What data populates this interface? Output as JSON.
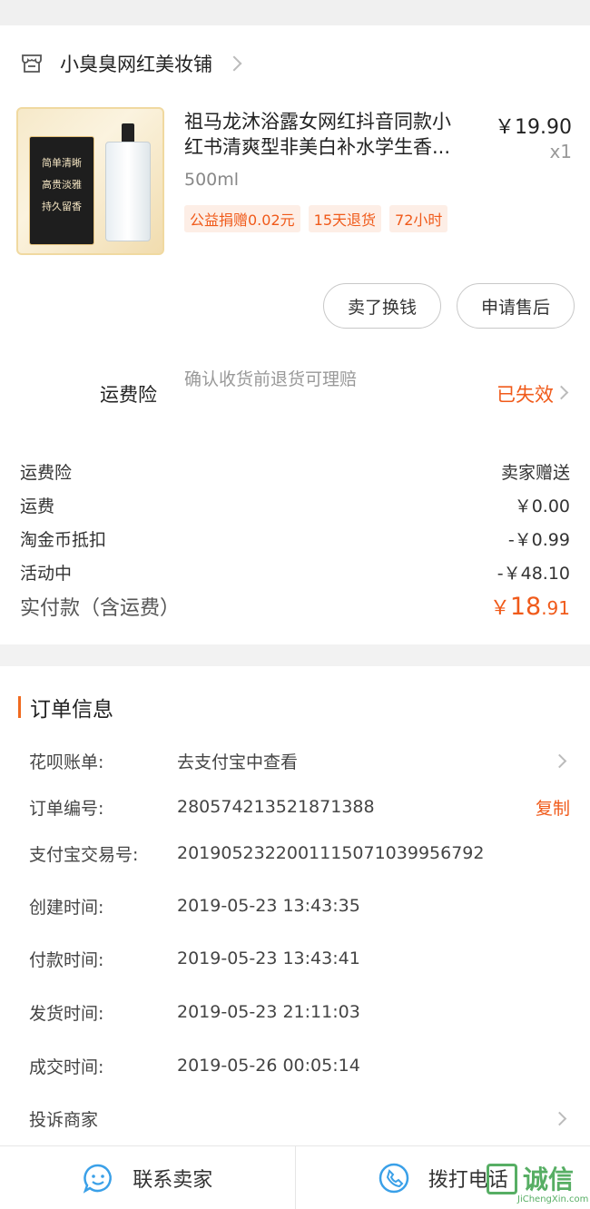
{
  "shop": {
    "name": "小臭臭网红美妆铺"
  },
  "product": {
    "title_line1": "祖马龙沐浴露女网红抖音同款小",
    "title_line2": "红书清爽型非美白补水学生香...",
    "price": "￥19.90",
    "quantity": "x1",
    "spec": "500ml",
    "tags": [
      "公益捐赠0.02元",
      "15天退货",
      "72小时"
    ],
    "image_card_lines": [
      "简单清晰",
      "高贵淡雅",
      "持久留香"
    ]
  },
  "actions": {
    "sell_label": "卖了换钱",
    "service_label": "申请售后"
  },
  "insurance": {
    "label": "运费险",
    "desc": "确认收货前退货可理赔",
    "status": "已失效"
  },
  "fees": [
    {
      "key": "运费险",
      "value": "卖家赠送"
    },
    {
      "key": "运费",
      "value": "￥0.00"
    },
    {
      "key": "淘金币抵扣",
      "value": "-￥0.99"
    },
    {
      "key": "活动中",
      "value": "-￥48.10"
    }
  ],
  "total": {
    "label": "实付款（含运费）",
    "currency": "￥",
    "int": "18",
    "dec": ".91"
  },
  "order": {
    "title": "订单信息",
    "rows": [
      {
        "key": "花呗账单:",
        "value": "去支付宝中查看"
      },
      {
        "key": "订单编号:",
        "value": "280574213521871388",
        "action": "复制"
      },
      {
        "key": "支付宝交易号:",
        "value": "2019052322001115071039956792"
      },
      {
        "key": "创建时间:",
        "value": "2019-05-23 13:43:35"
      },
      {
        "key": "付款时间:",
        "value": "2019-05-23 13:43:41"
      },
      {
        "key": "发货时间:",
        "value": "2019-05-23 21:11:03"
      },
      {
        "key": "成交时间:",
        "value": "2019-05-26 00:05:14"
      },
      {
        "key": "投诉商家",
        "value": ""
      }
    ]
  },
  "bottom": {
    "contact_label": "联系卖家",
    "call_label": "拨打电话"
  },
  "watermark": {
    "text": "诚信",
    "sub": "JiChengXin.com"
  },
  "colors": {
    "accent": "#f05a1a",
    "icon_blue": "#3aa0e8"
  }
}
